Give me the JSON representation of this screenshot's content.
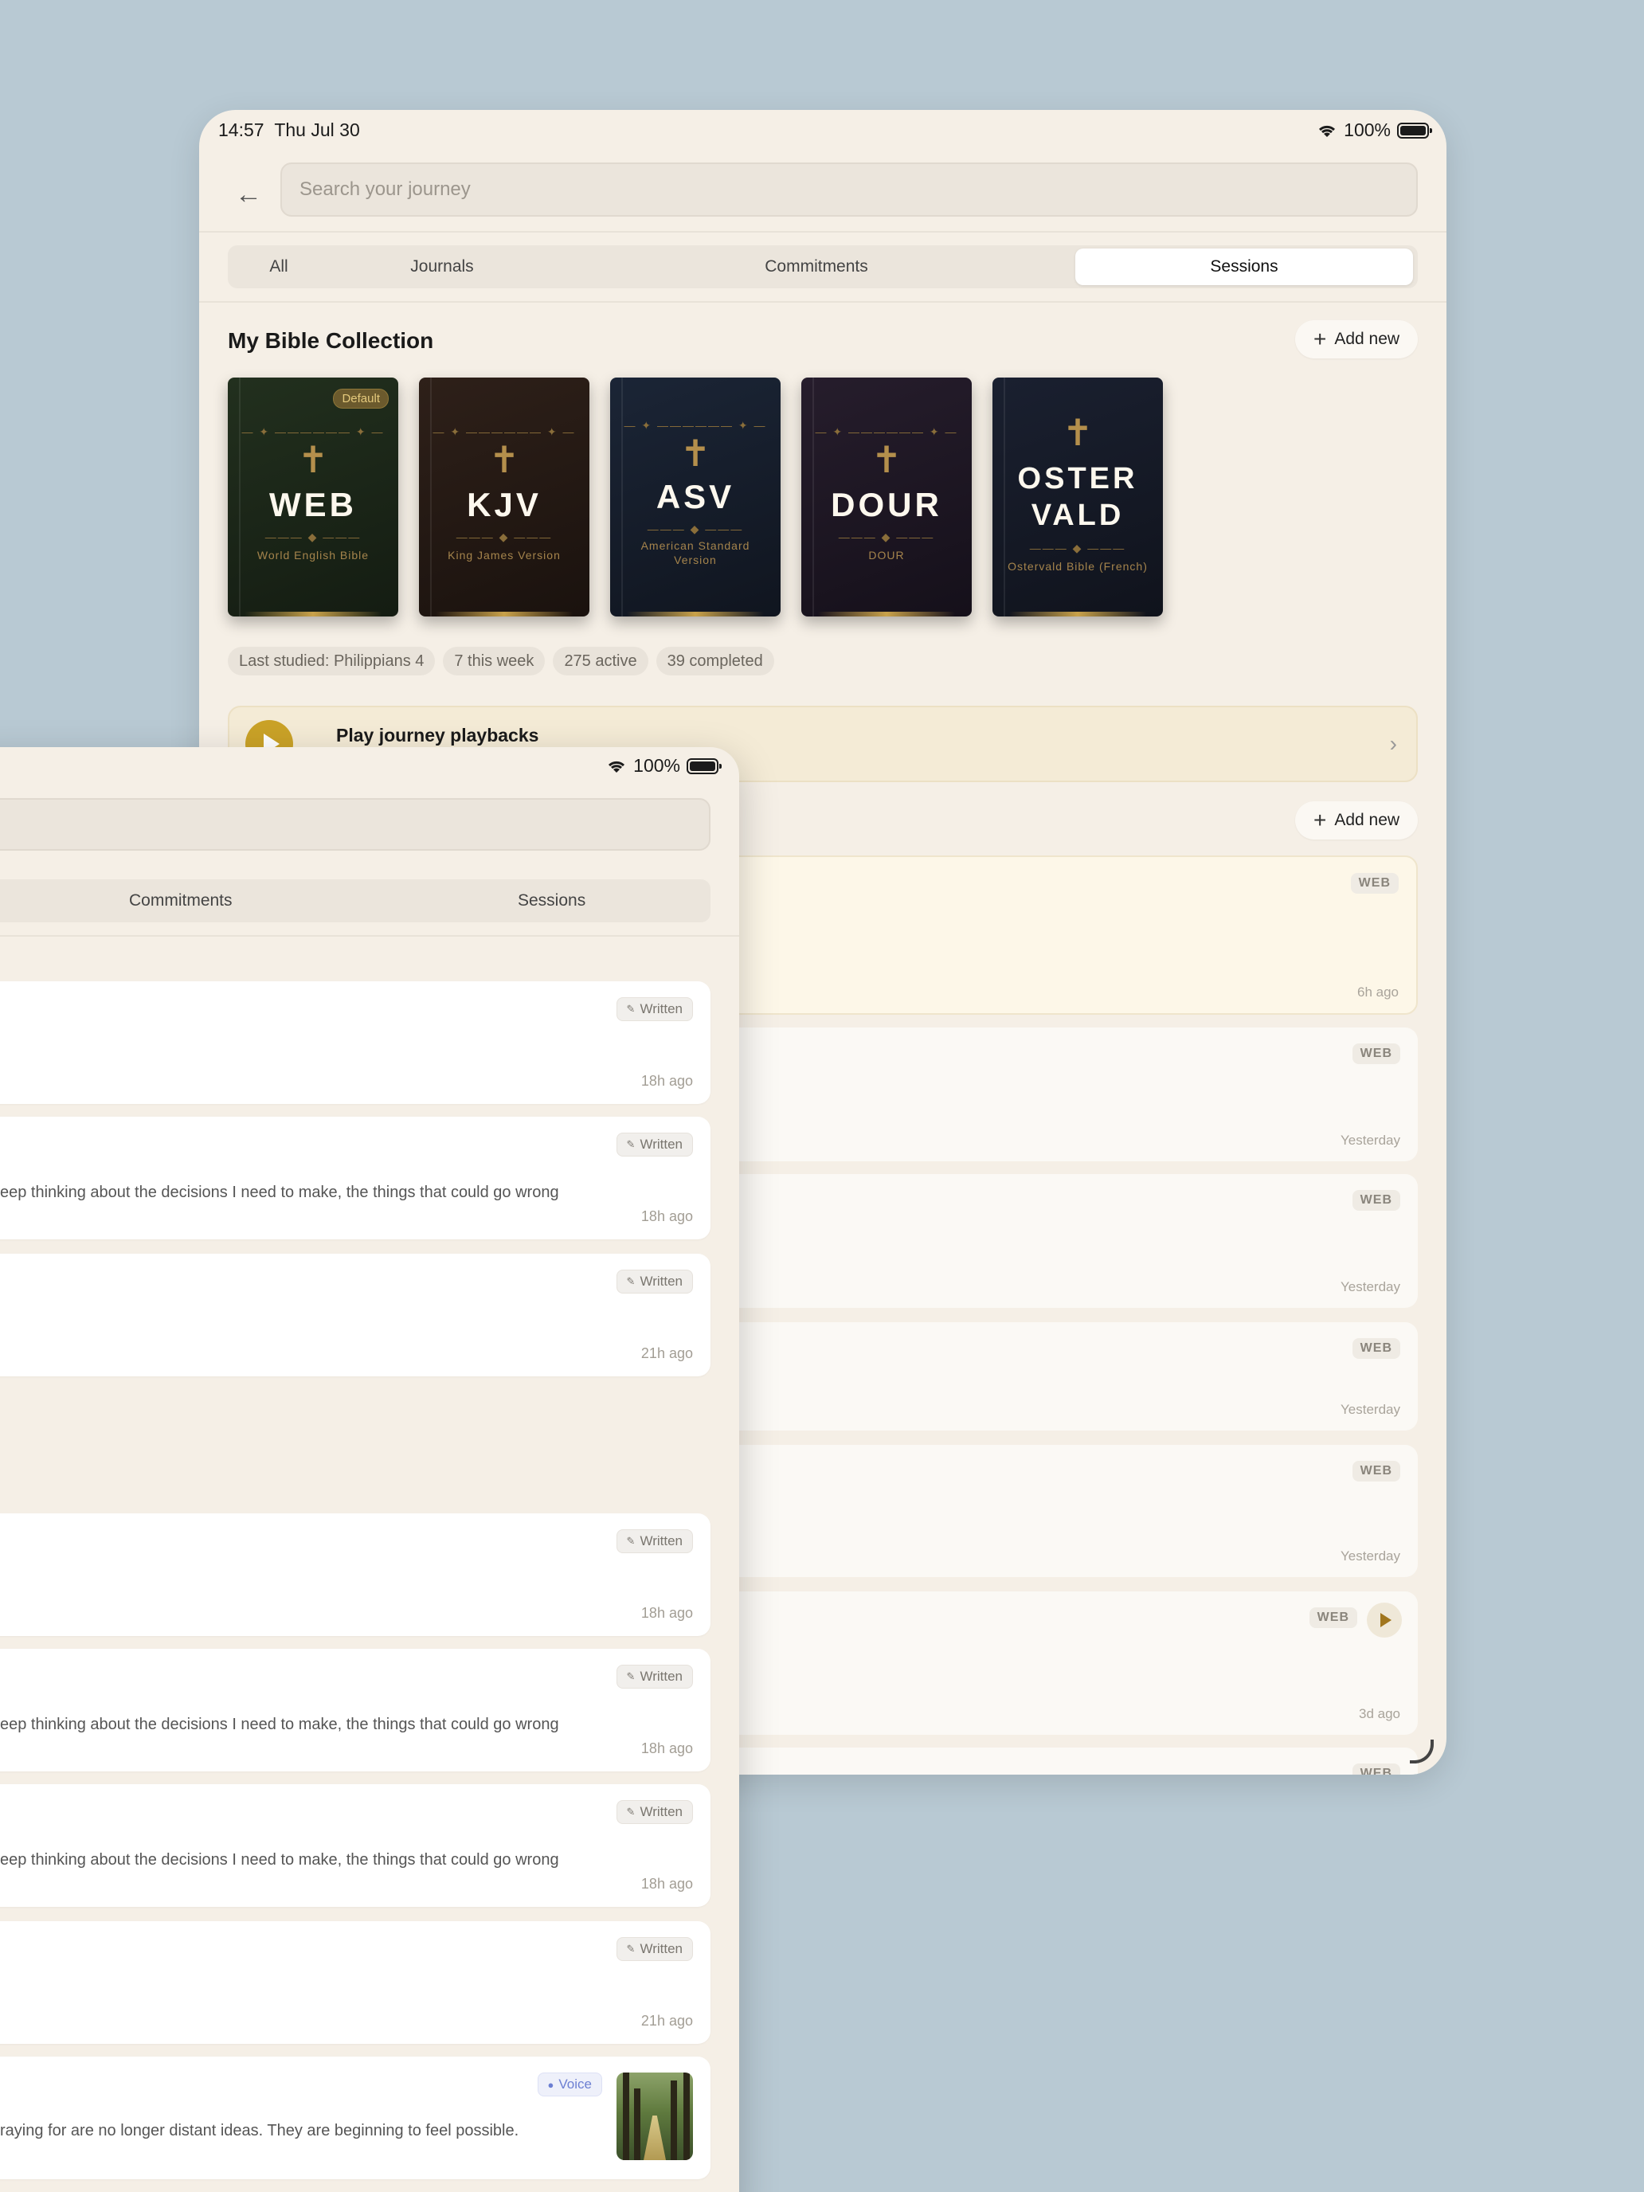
{
  "back": {
    "status": {
      "time": "14:57",
      "date": "Thu Jul 30",
      "battery": "100%"
    },
    "search": {
      "placeholder": "Search your journey"
    },
    "tabs": [
      "All",
      "Journals",
      "Commitments",
      "Sessions"
    ],
    "active_tab": "Sessions",
    "collection": {
      "title": "My Bible Collection",
      "add_label": "Add new",
      "books": [
        {
          "abbr": "WEB",
          "full": "World English Bible",
          "badge": "Default"
        },
        {
          "abbr": "KJV",
          "full": "King James Version"
        },
        {
          "abbr": "ASV",
          "full": "American Standard Version"
        },
        {
          "abbr": "DOUR",
          "full": "DOUR"
        },
        {
          "abbr_lines": [
            "OSTER",
            "VALD"
          ],
          "full": "Ostervald Bible (French)"
        }
      ]
    },
    "stats": [
      "Last studied: Philippians 4",
      "7 this week",
      "275 active",
      "39 completed"
    ],
    "playback": {
      "label": "Play journey playbacks"
    },
    "sessions_add_label": "Add new",
    "sessions": [
      {
        "version": "WEB",
        "time": "6h ago"
      },
      {
        "version": "WEB",
        "time": "Yesterday"
      },
      {
        "version": "WEB",
        "time": "Yesterday"
      },
      {
        "version": "WEB",
        "time": "Yesterday"
      },
      {
        "version": "WEB",
        "time": "Yesterday"
      },
      {
        "version": "WEB",
        "time": "3d ago"
      },
      {
        "version": "WEB"
      }
    ]
  },
  "front": {
    "status": {
      "battery": "100%"
    },
    "tabs": [
      "Commitments",
      "Sessions"
    ],
    "entries": [
      {
        "type": "Written",
        "time": "18h ago"
      },
      {
        "type": "Written",
        "time": "18h ago",
        "snippet": "eep thinking about the decisions I need to make, the things that could go wrong"
      },
      {
        "type": "Written",
        "time": "21h ago"
      },
      {
        "type": "Written",
        "time": "18h ago"
      },
      {
        "type": "Written",
        "time": "18h ago",
        "snippet": "eep thinking about the decisions I need to make, the things that could go wrong"
      },
      {
        "type": "Written",
        "time": "18h ago",
        "snippet": "eep thinking about the decisions I need to make, the things that could go wrong"
      },
      {
        "type": "Written",
        "time": "21h ago"
      },
      {
        "type": "Voice",
        "snippet": "raying for are no longer distant ideas. They are beginning to feel possible."
      }
    ]
  },
  "colors": {
    "background": "#b8c9d3",
    "surface": "#f5efe6",
    "accent_gold": "#caa227",
    "voice_blue": "#6c7fd2"
  },
  "icons": [
    "back-arrow-icon",
    "wifi-icon",
    "battery-icon",
    "plus-icon",
    "cross-icon",
    "play-icon",
    "chevron-right-icon",
    "pencil-icon",
    "microphone-icon",
    "resize-handle-icon"
  ]
}
